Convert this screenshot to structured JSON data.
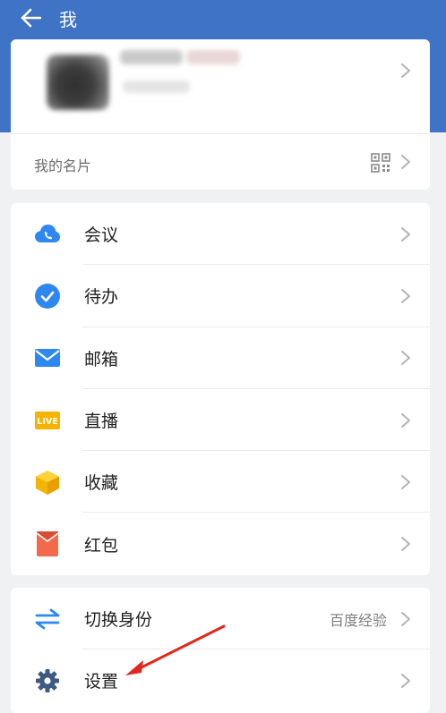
{
  "header": {
    "title": "我",
    "accent_color": "#3f73c5"
  },
  "profile": {
    "namecard_label": "我的名片"
  },
  "menu": {
    "items": [
      {
        "label": "会议",
        "icon": "meeting-cloud-icon",
        "color": "#2f88ef"
      },
      {
        "label": "待办",
        "icon": "todo-check-icon",
        "color": "#2f88ef"
      },
      {
        "label": "邮箱",
        "icon": "mail-icon",
        "color": "#2f88ef"
      },
      {
        "label": "直播",
        "icon": "live-icon",
        "color": "#f5b400",
        "icon_text": "LIVE"
      },
      {
        "label": "收藏",
        "icon": "favorites-box-icon",
        "color": "#f5b400"
      },
      {
        "label": "红包",
        "icon": "red-packet-icon",
        "color": "#f26a4b"
      }
    ]
  },
  "menu2": {
    "items": [
      {
        "label": "切换身份",
        "icon": "switch-identity-icon",
        "right_text": "百度经验"
      },
      {
        "label": "设置",
        "icon": "gear-icon"
      }
    ]
  }
}
